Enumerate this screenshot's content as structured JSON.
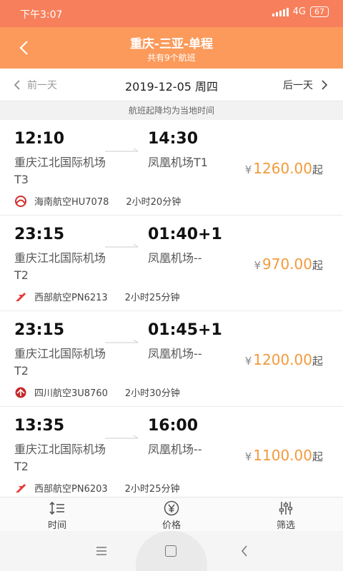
{
  "status_bar": {
    "time": "下午3:07",
    "network": "4G",
    "battery": "67"
  },
  "header": {
    "title": "重庆-三亚-单程",
    "subtitle": "共有9个航班",
    "back_icon": "chevron-left-icon"
  },
  "date_bar": {
    "prev_label": "前一天",
    "date": "2019-12-05 周四",
    "next_label": "后一天"
  },
  "notice": "航班起降均为当地时间",
  "flights": [
    {
      "dep_time": "12:10",
      "arr_time": "14:30",
      "dep_airport": "重庆江北国际机场T3",
      "arr_airport": "凤凰机场T1",
      "price": "1260.00",
      "currency": "¥",
      "price_suffix": "起",
      "airline": "海南航空HU7078",
      "duration": "2小时20分钟",
      "logo_color": "#d22f2f"
    },
    {
      "dep_time": "23:15",
      "arr_time": "01:40+1",
      "dep_airport": "重庆江北国际机场T2",
      "arr_airport": "凤凰机场--",
      "price": "970.00",
      "currency": "¥",
      "price_suffix": "起",
      "airline": "西部航空PN6213",
      "duration": "2小时25分钟",
      "logo_color": "#e53935"
    },
    {
      "dep_time": "23:15",
      "arr_time": "01:45+1",
      "dep_airport": "重庆江北国际机场T2",
      "arr_airport": "凤凰机场--",
      "price": "1200.00",
      "currency": "¥",
      "price_suffix": "起",
      "airline": "四川航空3U8760",
      "duration": "2小时30分钟",
      "logo_color": "#c62828"
    },
    {
      "dep_time": "13:35",
      "arr_time": "16:00",
      "dep_airport": "重庆江北国际机场T2",
      "arr_airport": "凤凰机场--",
      "price": "1100.00",
      "currency": "¥",
      "price_suffix": "起",
      "airline": "西部航空PN6203",
      "duration": "2小时25分钟",
      "logo_color": "#e53935"
    }
  ],
  "toolbar": {
    "time_label": "时间",
    "price_label": "价格",
    "filter_label": "筛选"
  },
  "colors": {
    "status_bar": "#f77f5c",
    "header": "#fb9a5a",
    "price": "#f39a3c"
  }
}
